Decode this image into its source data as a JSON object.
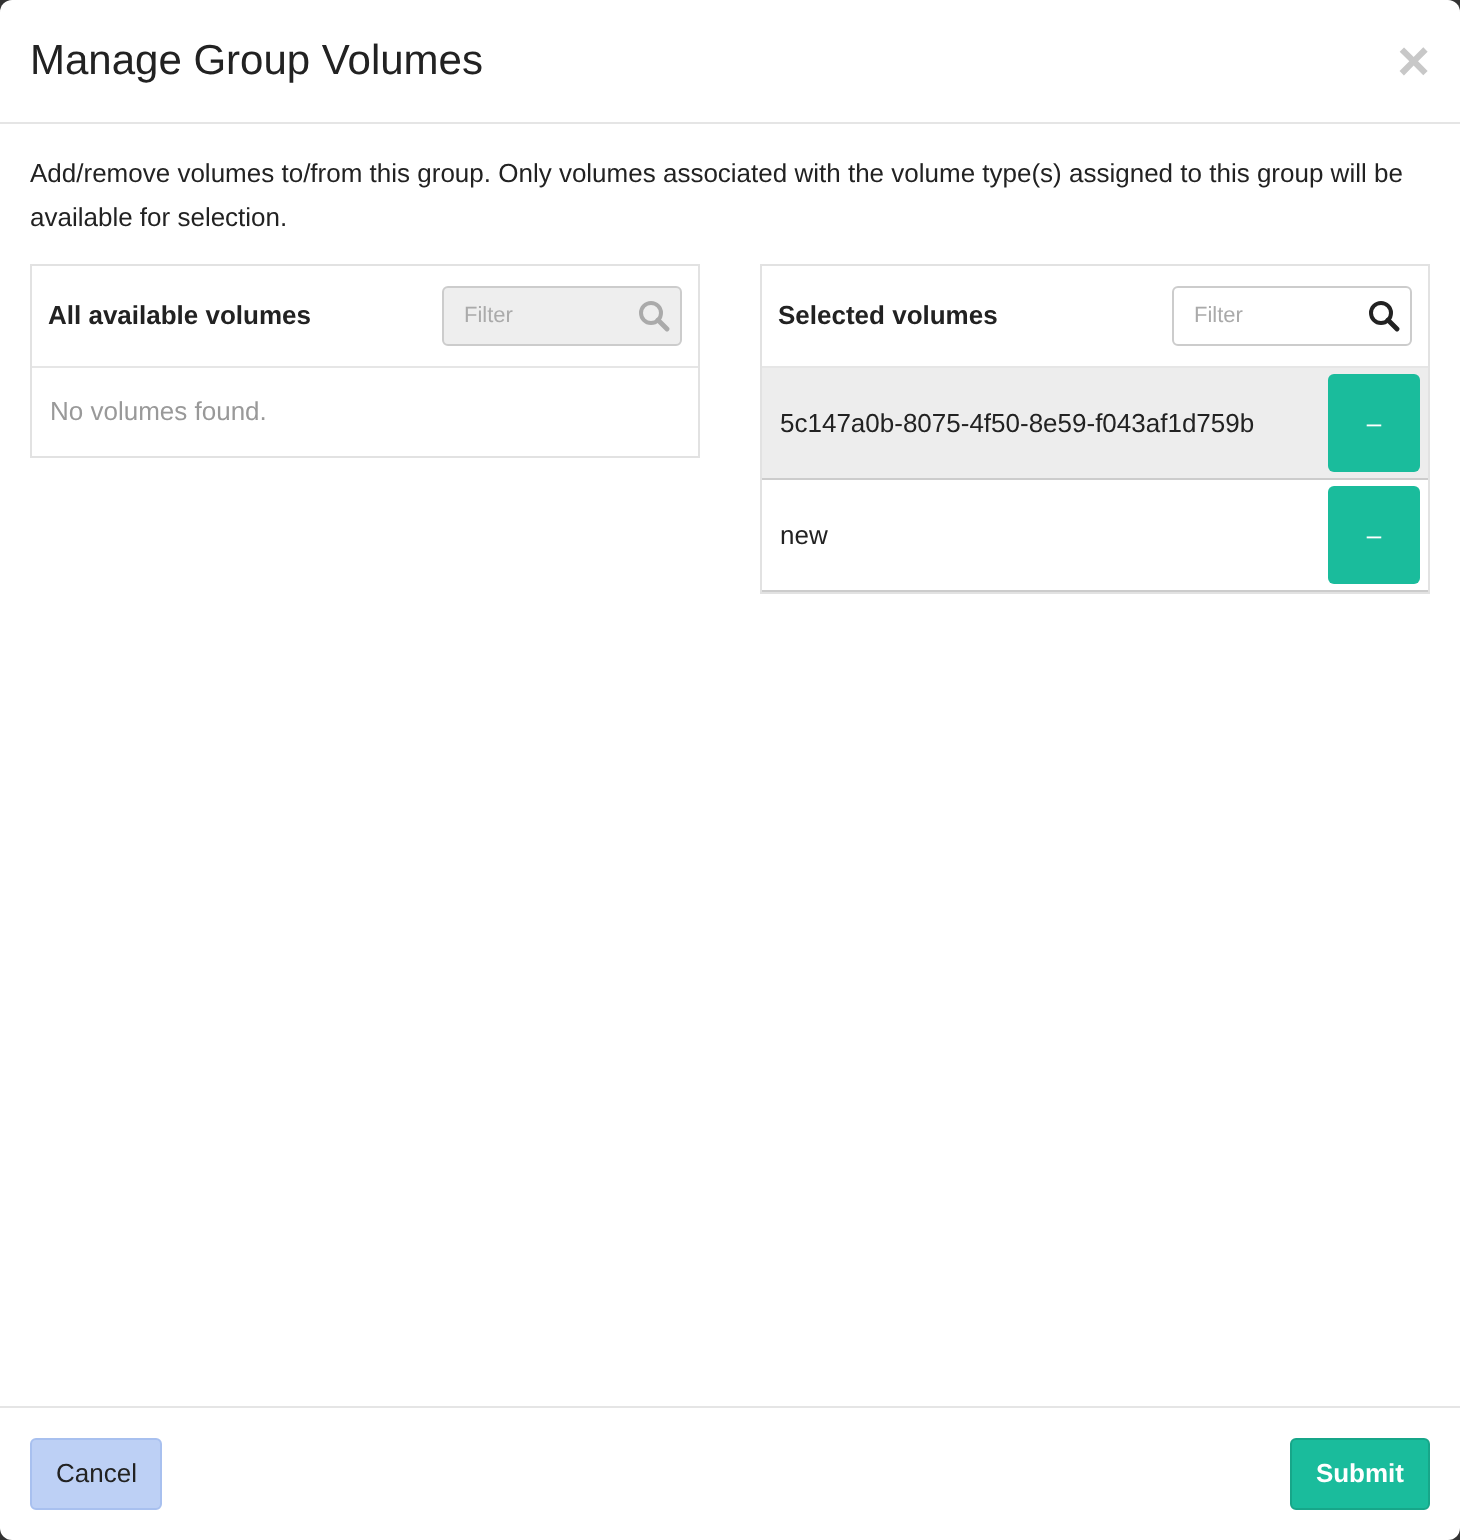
{
  "dialog": {
    "title": "Manage Group Volumes",
    "close": "×"
  },
  "description": "Add/remove volumes to/from this group. Only volumes associated with the volume type(s) assigned to this group will be available for selection.",
  "available": {
    "heading": "All available volumes",
    "filter": {
      "placeholder": "Filter",
      "disabled": true
    },
    "empty_text": "No volumes found."
  },
  "selected": {
    "heading": "Selected volumes",
    "filter": {
      "placeholder": "Filter",
      "disabled": false
    },
    "rows": [
      {
        "name": "5c147a0b-8075-4f50-8e59-f043af1d759b",
        "highlighted": true,
        "action": "–"
      },
      {
        "name": "new",
        "highlighted": false,
        "action": "–"
      }
    ]
  },
  "buttons": {
    "cancel": "Cancel",
    "submit": "Submit"
  }
}
